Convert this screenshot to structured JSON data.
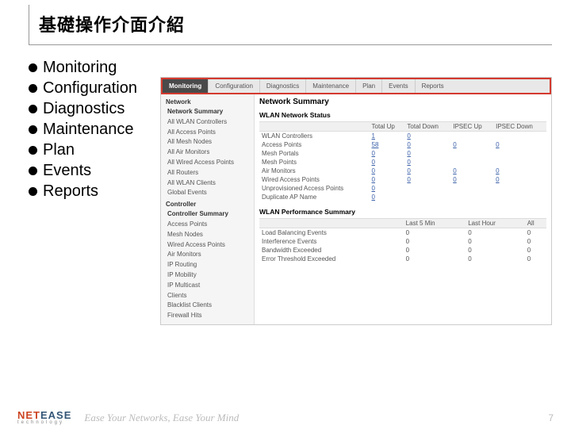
{
  "title": "基礎操作介面介紹",
  "bullets": [
    "Monitoring",
    "Configuration",
    "Diagnostics",
    "Maintenance",
    "Plan",
    "Events",
    "Reports"
  ],
  "tabs": [
    "Monitoring",
    "Configuration",
    "Diagnostics",
    "Maintenance",
    "Plan",
    "Events",
    "Reports"
  ],
  "sidebar": {
    "section1": {
      "head": "Network",
      "items": [
        "Network Summary",
        "All WLAN Controllers",
        "All Access Points",
        "All Mesh Nodes",
        "All Air Monitors",
        "All Wired Access Points",
        "All Routers",
        "All WLAN Clients",
        "Global Events"
      ]
    },
    "section2": {
      "head": "Controller",
      "items": [
        "Controller Summary",
        "Access Points",
        "Mesh Nodes",
        "Wired Access Points",
        "Air Monitors",
        "IP Routing",
        "IP Mobility",
        "IP Multicast",
        "Clients",
        "Blacklist Clients",
        "Firewall Hits"
      ]
    }
  },
  "summary": {
    "title": "Network Summary",
    "status": {
      "subhead": "WLAN Network Status",
      "cols": [
        "",
        "Total Up",
        "Total Down",
        "IPSEC Up",
        "IPSEC Down"
      ],
      "rows": [
        {
          "label": "WLAN Controllers",
          "v": [
            "1",
            "0",
            "",
            ""
          ]
        },
        {
          "label": "Access Points",
          "v": [
            "58",
            "0",
            "0",
            "0"
          ]
        },
        {
          "label": "Mesh Portals",
          "v": [
            "0",
            "0",
            "",
            ""
          ]
        },
        {
          "label": "Mesh Points",
          "v": [
            "0",
            "0",
            "",
            ""
          ]
        },
        {
          "label": "Air Monitors",
          "v": [
            "0",
            "0",
            "0",
            "0"
          ]
        },
        {
          "label": "Wired Access Points",
          "v": [
            "0",
            "0",
            "0",
            "0"
          ]
        },
        {
          "label": "Unprovisioned Access Points",
          "v": [
            "0",
            "",
            "",
            ""
          ]
        },
        {
          "label": "Duplicate AP Name",
          "v": [
            "0",
            "",
            "",
            ""
          ]
        }
      ]
    },
    "perf": {
      "subhead": "WLAN Performance Summary",
      "cols": [
        "",
        "Last 5 Min",
        "Last Hour",
        "All"
      ],
      "rows": [
        {
          "label": "Load Balancing Events",
          "v": [
            "0",
            "0",
            "0"
          ]
        },
        {
          "label": "Interference Events",
          "v": [
            "0",
            "0",
            "0"
          ]
        },
        {
          "label": "Bandwidth Exceeded",
          "v": [
            "0",
            "0",
            "0"
          ]
        },
        {
          "label": "Error Threshold Exceeded",
          "v": [
            "0",
            "0",
            "0"
          ]
        }
      ]
    }
  },
  "footer": {
    "logo_ne": "NET",
    "logo_te": "EASE",
    "logo_sub": "technology",
    "slogan": "Ease Your Networks, Ease Your Mind",
    "page": "7"
  }
}
